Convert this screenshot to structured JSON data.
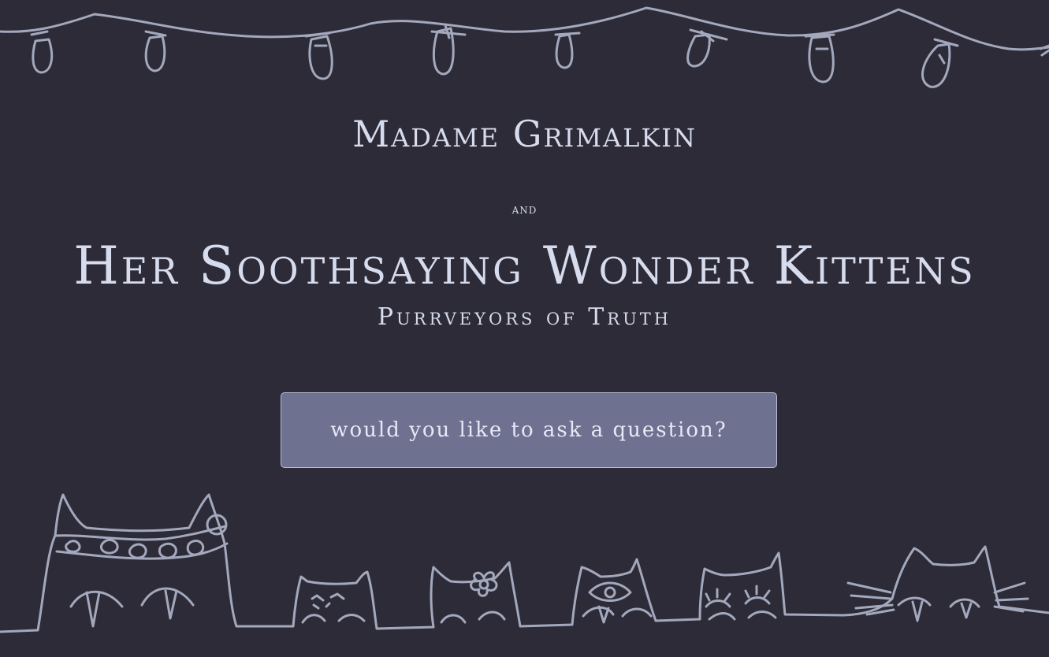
{
  "header": {
    "name": "Madame Grimalkin",
    "connector": "and",
    "troupe": "Her Soothsaying Wonder Kittens",
    "tagline": "Purrveyors of Truth"
  },
  "cta": {
    "label": "would you like to ask a question?"
  },
  "colors": {
    "background": "#2c2b37",
    "text": "#d7dbee",
    "line_art": "#a3a8bd",
    "button": "#6e718f"
  },
  "decor": {
    "lights": "string-lights-icon",
    "cats": "peeking-cats-icon"
  }
}
